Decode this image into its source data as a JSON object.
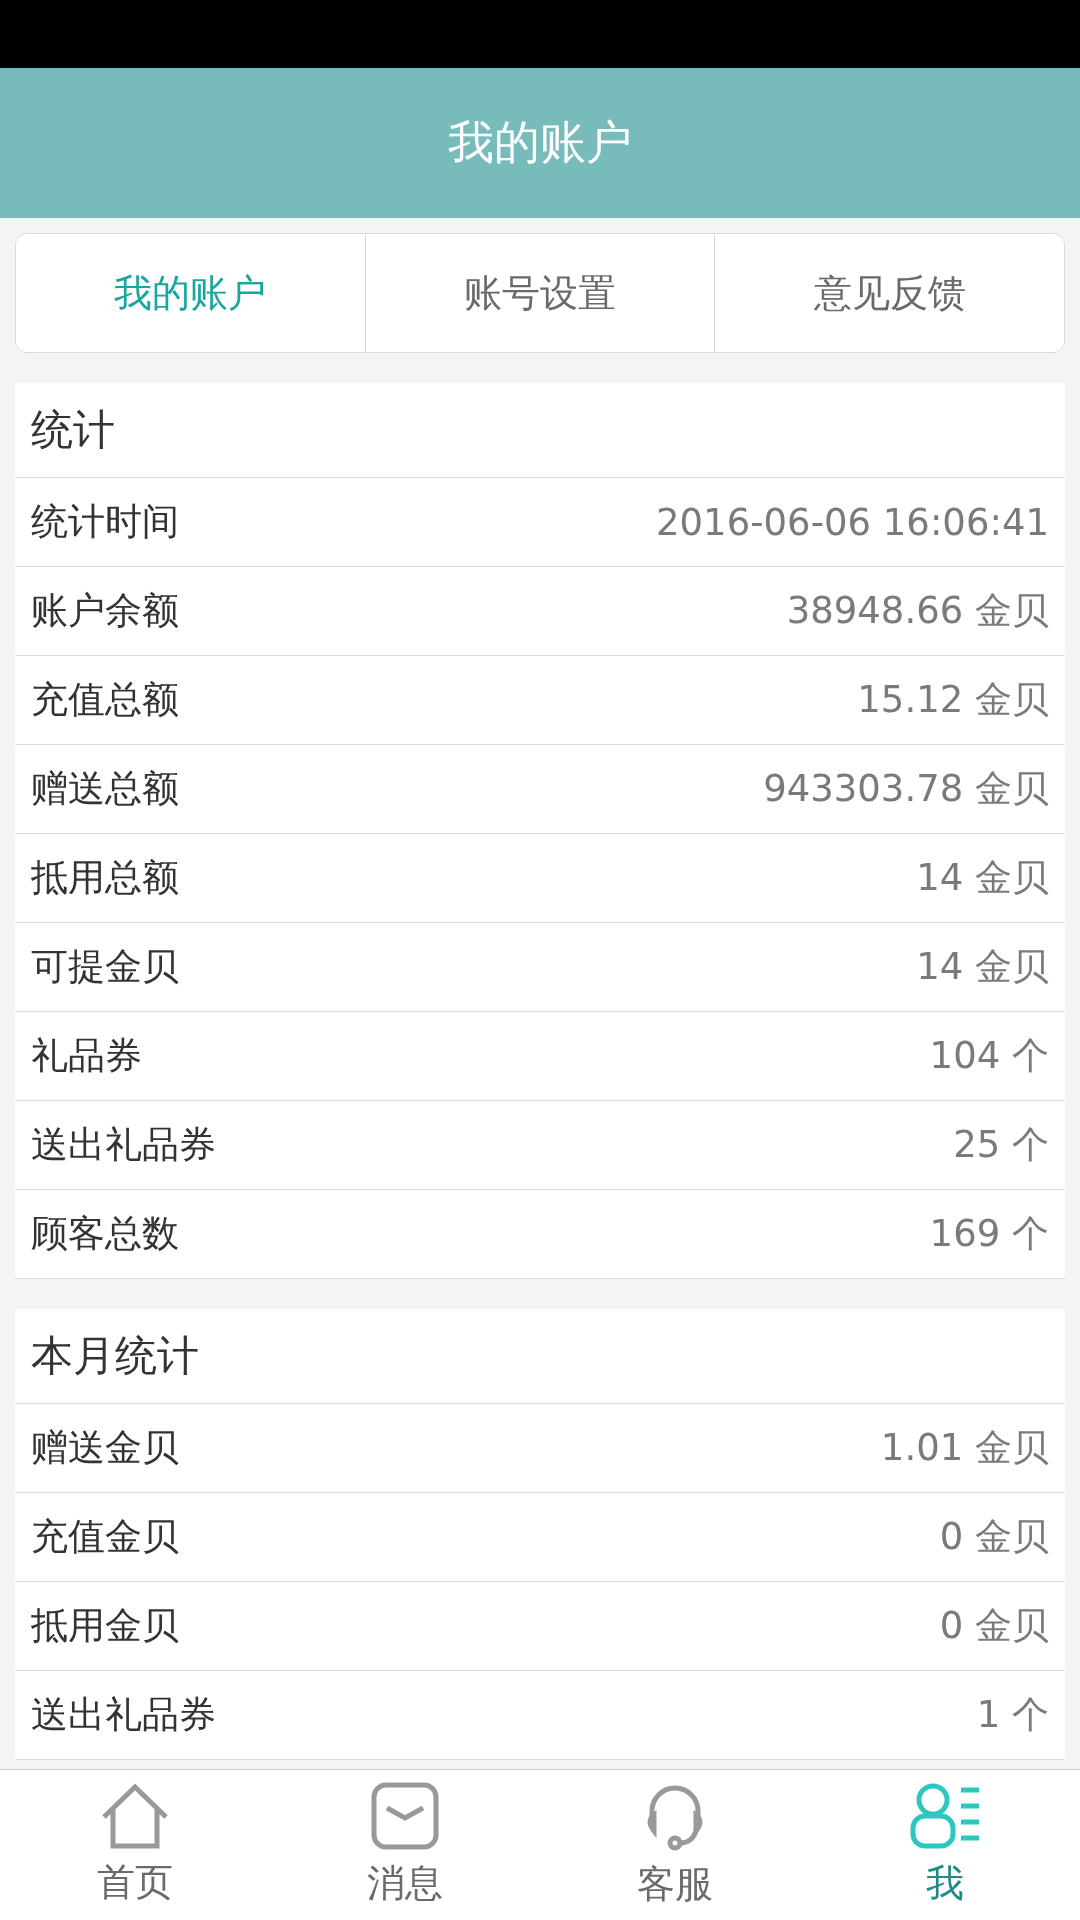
{
  "header": {
    "title": "我的账户"
  },
  "tabs": [
    {
      "label": "我的账户",
      "selected": true
    },
    {
      "label": "账号设置",
      "selected": false
    },
    {
      "label": "意见反馈",
      "selected": false
    }
  ],
  "sections": [
    {
      "title": "统计",
      "rows": [
        {
          "label": "统计时间",
          "value": "2016-06-06 16:06:41"
        },
        {
          "label": "账户余额",
          "value": "38948.66 金贝"
        },
        {
          "label": "充值总额",
          "value": "15.12 金贝"
        },
        {
          "label": "赠送总额",
          "value": "943303.78 金贝"
        },
        {
          "label": "抵用总额",
          "value": "14 金贝"
        },
        {
          "label": "可提金贝",
          "value": "14 金贝"
        },
        {
          "label": "礼品券",
          "value": "104 个"
        },
        {
          "label": "送出礼品券",
          "value": "25 个"
        },
        {
          "label": "顾客总数",
          "value": "169 个"
        }
      ]
    },
    {
      "title": "本月统计",
      "rows": [
        {
          "label": "赠送金贝",
          "value": "1.01 金贝"
        },
        {
          "label": "充值金贝",
          "value": "0 金贝"
        },
        {
          "label": "抵用金贝",
          "value": "0 金贝"
        },
        {
          "label": "送出礼品券",
          "value": "1 个"
        }
      ]
    }
  ],
  "nav": [
    {
      "kind": "home",
      "label": "首页",
      "selected": false
    },
    {
      "kind": "message",
      "label": "消息",
      "selected": false
    },
    {
      "kind": "service",
      "label": "客服",
      "selected": false
    },
    {
      "kind": "me",
      "label": "我",
      "selected": true
    }
  ]
}
